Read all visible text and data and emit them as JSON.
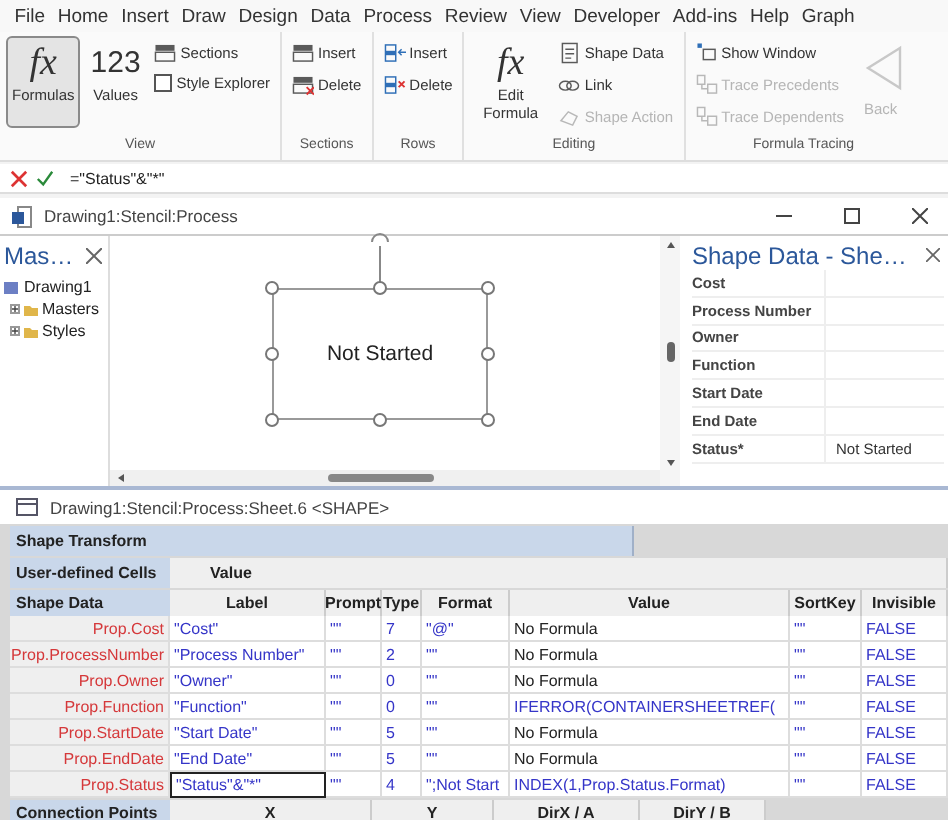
{
  "menu": [
    {
      "label": "File"
    },
    {
      "label": "Home"
    },
    {
      "label": "Insert"
    },
    {
      "label": "Draw"
    },
    {
      "label": "Design"
    },
    {
      "label": "Data"
    },
    {
      "label": "Process"
    },
    {
      "label": "Review"
    },
    {
      "label": "View"
    },
    {
      "label": "Developer"
    },
    {
      "label": "Add-ins"
    },
    {
      "label": "Help"
    },
    {
      "label": "Graph"
    }
  ],
  "ribbon": {
    "groups": [
      {
        "label": "View",
        "items": [
          {
            "kind": "large",
            "glyph": "fx",
            "label": "Formulas",
            "selected": true
          },
          {
            "kind": "large",
            "glyph": "123",
            "label": "Values",
            "selected": false
          },
          {
            "kind": "small",
            "label": "Sections",
            "disabled": false
          },
          {
            "kind": "checkbox",
            "label": "Style Explorer",
            "checked": false
          }
        ]
      },
      {
        "label": "Sections",
        "items": [
          {
            "kind": "small",
            "label": "Insert",
            "disabled": false
          },
          {
            "kind": "small",
            "label": "Delete",
            "disabled": false
          }
        ]
      },
      {
        "label": "Rows",
        "items": [
          {
            "kind": "small",
            "label": "Insert",
            "disabled": false
          },
          {
            "kind": "small",
            "label": "Delete",
            "disabled": false
          }
        ]
      },
      {
        "label": "Editing",
        "items": [
          {
            "kind": "large",
            "glyph": "fx",
            "label": "Edit Formula",
            "selected": false
          },
          {
            "kind": "small",
            "label": "Shape Data",
            "disabled": false
          },
          {
            "kind": "small",
            "label": "Link",
            "disabled": false
          },
          {
            "kind": "small",
            "label": "Shape Action",
            "disabled": true
          }
        ]
      },
      {
        "label": "Formula Tracing",
        "items": [
          {
            "kind": "small",
            "label": "Show Window",
            "disabled": false
          },
          {
            "kind": "small",
            "label": "Trace Precedents",
            "disabled": true
          },
          {
            "kind": "small",
            "label": "Trace Dependents",
            "disabled": true
          },
          {
            "kind": "back",
            "label": "Back",
            "disabled": true
          }
        ]
      }
    ]
  },
  "formula_bar": {
    "formula": "=\"Status\"&\"*\""
  },
  "window": {
    "title": "Drawing1:Stencil:Process"
  },
  "masters_panel": {
    "title": "Mas…",
    "tree": [
      {
        "label": "Drawing1",
        "children": [
          {
            "label": "Masters",
            "expanded": false
          },
          {
            "label": "Styles",
            "expanded": false
          }
        ]
      }
    ]
  },
  "canvas": {
    "shape_text": "Not Started"
  },
  "shape_data_panel": {
    "title": "Shape Data - She…",
    "rows": [
      {
        "label": "Cost"
      },
      {
        "label": "Process Number"
      },
      {
        "label": "Owner"
      },
      {
        "label": "Function"
      },
      {
        "label": "Start Date"
      },
      {
        "label": "End Date"
      },
      {
        "label": "Status*",
        "value": "Not Started"
      }
    ]
  },
  "sheet": {
    "title": "Drawing1:Stencil:Process:Sheet.6 <SHAPE>",
    "shape_transform": "Shape Transform",
    "user_defined": {
      "label": "User-defined Cells",
      "columns": [
        "Value"
      ]
    },
    "shape_data": {
      "label": "Shape Data",
      "columns": [
        "Label",
        "Prompt",
        "Type",
        "Format",
        "Value",
        "SortKey",
        "Invisible"
      ],
      "rows": [
        {
          "name": "Prop.Cost",
          "label": "\"Cost\"",
          "prompt": "\"\"",
          "type": "7",
          "format": "\"@\"",
          "value": "No Formula",
          "value_is_formula": false,
          "sortkey": "\"\"",
          "invisible": "FALSE",
          "selected": false
        },
        {
          "name": "Prop.ProcessNumber",
          "label": "\"Process Number\"",
          "prompt": "\"\"",
          "type": "2",
          "format": "\"\"",
          "value": "No Formula",
          "value_is_formula": false,
          "sortkey": "\"\"",
          "invisible": "FALSE",
          "selected": false
        },
        {
          "name": "Prop.Owner",
          "label": "\"Owner\"",
          "prompt": "\"\"",
          "type": "0",
          "format": "\"\"",
          "value": "No Formula",
          "value_is_formula": false,
          "sortkey": "\"\"",
          "invisible": "FALSE",
          "selected": false
        },
        {
          "name": "Prop.Function",
          "label": "\"Function\"",
          "prompt": "\"\"",
          "type": "0",
          "format": "\"\"",
          "value": "IFERROR(CONTAINERSHEETREF(",
          "value_is_formula": true,
          "sortkey": "\"\"",
          "invisible": "FALSE",
          "selected": false
        },
        {
          "name": "Prop.StartDate",
          "label": "\"Start Date\"",
          "prompt": "\"\"",
          "type": "5",
          "format": "\"\"",
          "value": "No Formula",
          "value_is_formula": false,
          "sortkey": "\"\"",
          "invisible": "FALSE",
          "selected": false
        },
        {
          "name": "Prop.EndDate",
          "label": "\"End Date\"",
          "prompt": "\"\"",
          "type": "5",
          "format": "\"\"",
          "value": "No Formula",
          "value_is_formula": false,
          "sortkey": "\"\"",
          "invisible": "FALSE",
          "selected": false
        },
        {
          "name": "Prop.Status",
          "label": "\"Status\"&\"*\"",
          "prompt": "\"\"",
          "type": "4",
          "format": "\";Not Start",
          "value": "INDEX(1,Prop.Status.Format)",
          "value_is_formula": true,
          "sortkey": "\"\"",
          "invisible": "FALSE",
          "selected": true
        }
      ]
    },
    "connection_points": {
      "label": "Connection Points",
      "columns": [
        "X",
        "Y",
        "DirX / A",
        "DirY / B"
      ]
    }
  }
}
